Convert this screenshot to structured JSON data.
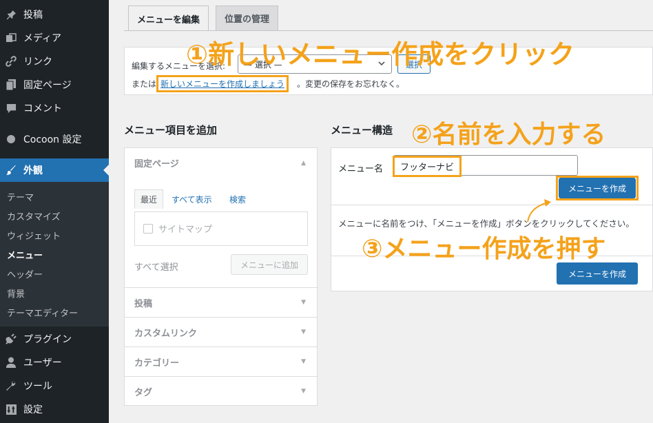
{
  "sidebar": {
    "items": [
      {
        "label": "投稿",
        "icon": "pin-icon"
      },
      {
        "label": "メディア",
        "icon": "media-icon"
      },
      {
        "label": "リンク",
        "icon": "link-icon"
      },
      {
        "label": "固定ページ",
        "icon": "page-icon"
      },
      {
        "label": "コメント",
        "icon": "comment-icon"
      },
      {
        "label": "Cocoon 設定",
        "icon": "circle-icon"
      },
      {
        "label": "外観",
        "icon": "brush-icon"
      },
      {
        "label": "プラグイン",
        "icon": "plugin-icon"
      },
      {
        "label": "ユーザー",
        "icon": "user-icon"
      },
      {
        "label": "ツール",
        "icon": "wrench-icon"
      },
      {
        "label": "設定",
        "icon": "settings-icon"
      }
    ],
    "submenu": [
      "テーマ",
      "カスタマイズ",
      "ウィジェット",
      "メニュー",
      "ヘッダー",
      "背景",
      "テーマエディター"
    ],
    "current_submenu": "メニュー"
  },
  "tabs": {
    "edit": "メニューを編集",
    "locations": "位置の管理"
  },
  "select_panel": {
    "label": "編集するメニューを選択:",
    "select_value": "— 選択 —",
    "select_button": "選択",
    "prefix": "または",
    "create_link": "新しいメニューを作成しましょう",
    "suffix": "。変更の保存をお忘れなく。"
  },
  "left": {
    "heading": "メニュー項目を追加",
    "sections": [
      "固定ページ",
      "投稿",
      "カスタムリンク",
      "カテゴリー",
      "タグ"
    ],
    "subtabs": [
      "最近",
      "すべて表示",
      "検索"
    ],
    "checkbox_label": "サイトマップ",
    "select_all": "すべて選択",
    "add_button": "メニューに追加"
  },
  "right": {
    "heading": "メニュー構造",
    "name_label": "メニュー名",
    "name_value": "フッターナビ",
    "create_button": "メニューを作成",
    "help_text": "メニューに名前をつけ、「メニューを作成」ボタンをクリックしてください。"
  },
  "annotations": {
    "step1": "①新しいメニュー作成をクリック",
    "step2": "②名前を入力する",
    "step3": "③メニュー作成を押す",
    "color": "#f4a21b"
  },
  "colors": {
    "sidebar_bg": "#1d2327",
    "accent": "#2271b1",
    "highlight": "#f4a21b"
  }
}
